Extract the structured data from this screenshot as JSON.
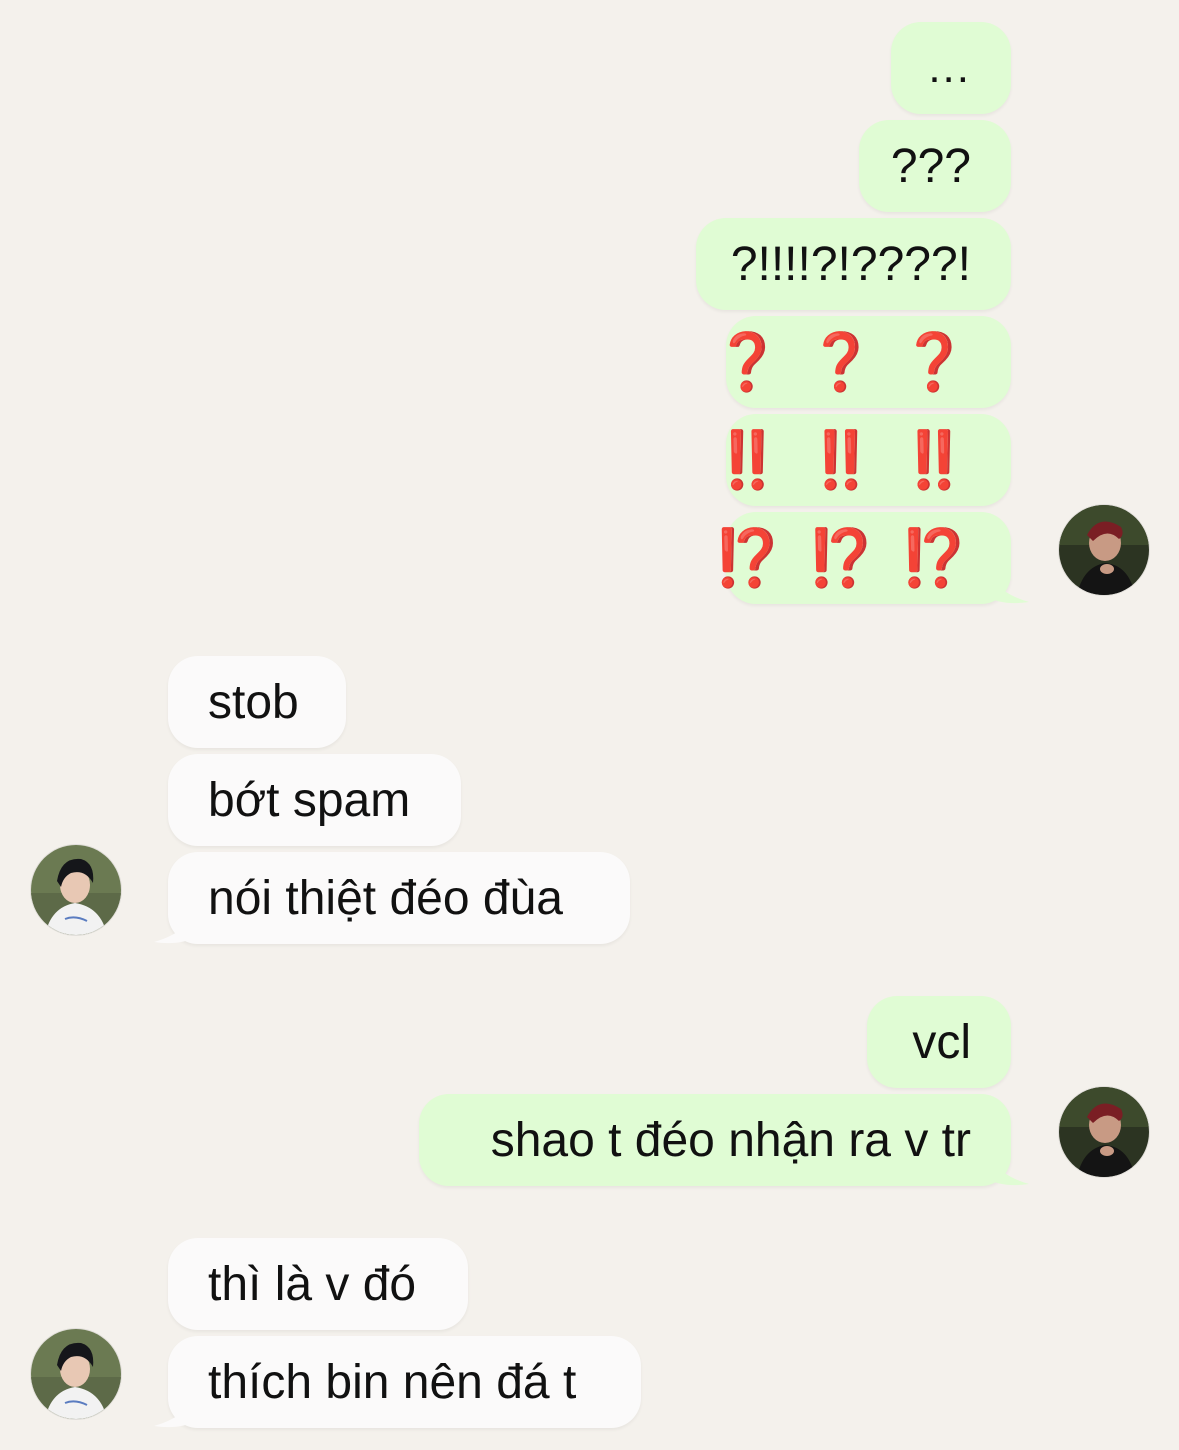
{
  "colors": {
    "background": "#f4f1ec",
    "outgoing_bubble": "#e0fcd4",
    "incoming_bubble": "#fbfafa",
    "emoji_red": "#d81e12"
  },
  "avatars": {
    "self": "avatar-red-hair",
    "friend": "avatar-dark-hair"
  },
  "messages": [
    {
      "side": "out",
      "text": "..."
    },
    {
      "side": "out",
      "text": "???"
    },
    {
      "side": "out",
      "text": "?!!!!?!????!"
    },
    {
      "side": "out",
      "text": "❓ ❓ ❓"
    },
    {
      "side": "out",
      "text": "‼️ ‼️ ‼️"
    },
    {
      "side": "out",
      "text": "⁉️ ⁉️ ⁉️"
    },
    {
      "side": "in",
      "text": "stob"
    },
    {
      "side": "in",
      "text": "bớt spam"
    },
    {
      "side": "in",
      "text": "nói thiệt đéo đùa"
    },
    {
      "side": "out",
      "text": "vcl"
    },
    {
      "side": "out",
      "text": "shao t đéo nhận ra v tr"
    },
    {
      "side": "in",
      "text": "thì là v đó"
    },
    {
      "side": "in",
      "text": "thích bin nên đá t"
    }
  ]
}
